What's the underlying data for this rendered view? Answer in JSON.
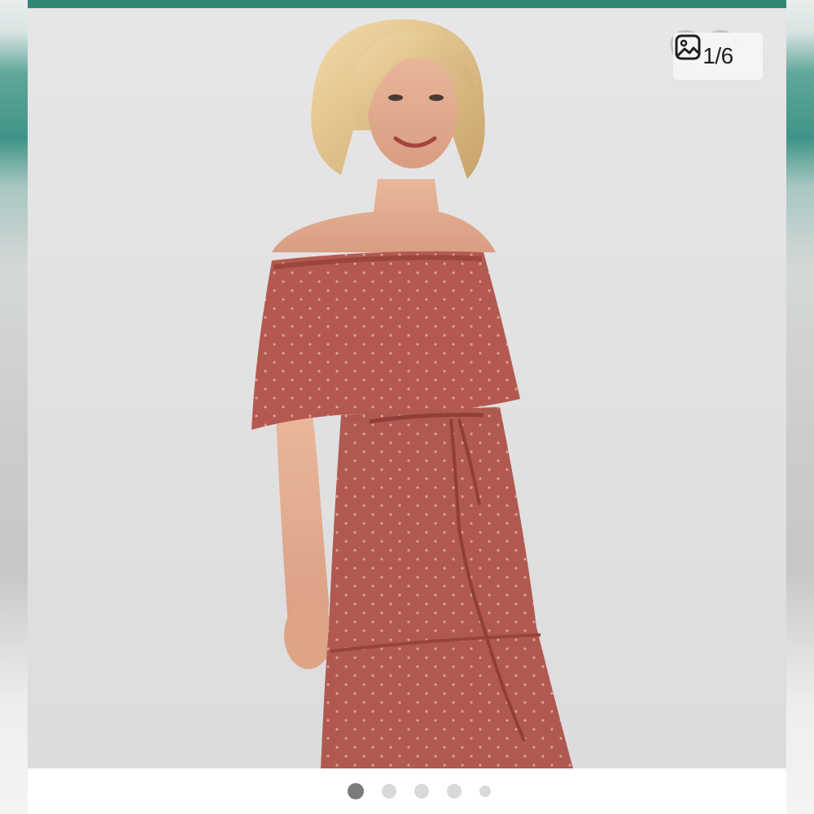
{
  "gallery": {
    "counter_text": "1/6",
    "icon": "gallery-icon",
    "current_index": 1,
    "total": 6,
    "dot_count": 5,
    "active_dot": 0
  },
  "colors": {
    "top_bar": "#2f8676",
    "dress": "#b4594f",
    "dot_active": "#7b7b7b",
    "dot_inactive": "#d9d9d9"
  }
}
